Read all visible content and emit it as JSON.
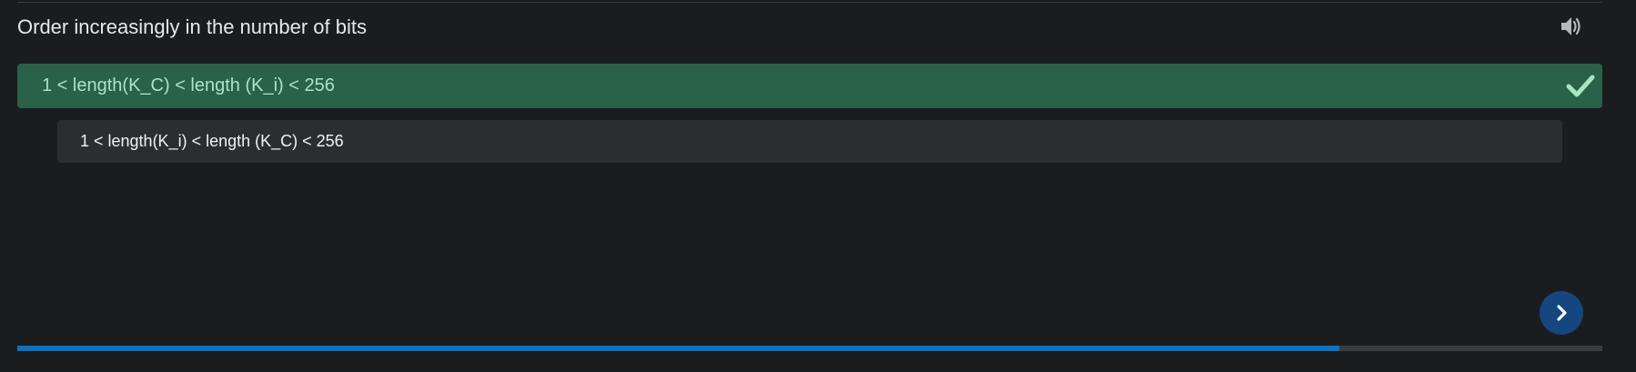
{
  "question": {
    "text": "Order increasingly in the number of bits"
  },
  "options": [
    {
      "label": "1 < length(K_C) < length (K_i) < 256",
      "state": "correct"
    },
    {
      "label": "1 < length(K_i) < length (K_C) < 256",
      "state": "neutral"
    }
  ],
  "icons": {
    "speaker": "speaker-icon",
    "check": "check-icon",
    "next": "chevron-right-icon"
  },
  "progress": {
    "fraction": 0.834
  },
  "colors": {
    "background": "#1b1c1e",
    "correct_bg": "#296149",
    "correct_text": "#a6e6c2",
    "check": "#a6e6c2",
    "option_bg": "#2b2e31",
    "next_button": "#15467f",
    "progress_fill": "#0b72c4",
    "progress_track": "#3b3c3f"
  }
}
